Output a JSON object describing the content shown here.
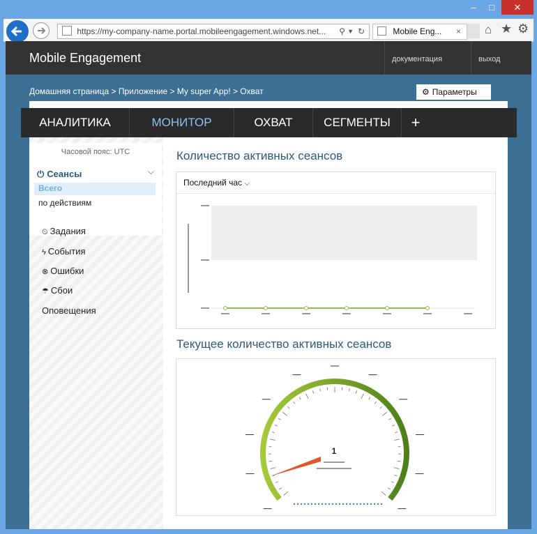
{
  "browser": {
    "url": "https://my-company-name.portal.mobileengagement.windows.net...",
    "tab_title": "Mobile Eng...",
    "tab_close": "×",
    "title_buttons": [
      "–",
      "□",
      "✕"
    ]
  },
  "header": {
    "app_title": "Mobile Engagement",
    "docs_link": "документация",
    "logout_link": "выход"
  },
  "breadcrumb": "Домашняя страница > Приложение > My super App! > Охват",
  "params_button": "Параметры",
  "topnav": {
    "items": [
      "АНАЛИТИКА",
      "МОНИТОР",
      "ОХВАТ",
      "СЕГМЕНТЫ"
    ],
    "active": "МОНИТОР",
    "add_label": "+"
  },
  "sidebar": {
    "timezone": "Часовой пояс: UTC",
    "sessions_label": "Сеансы",
    "sub_items": [
      "Всего",
      "по действиям"
    ],
    "items": [
      {
        "label": "Задания",
        "icon": "timer-icon"
      },
      {
        "label": "События",
        "icon": "lightning-icon"
      },
      {
        "label": "Ошибки",
        "icon": "error-icon"
      },
      {
        "label": "Сбои",
        "icon": "umbrella-icon"
      }
    ],
    "alerts_label": "Оповещения"
  },
  "active_sessions": {
    "title": "Количество активных сеансов",
    "range_selector": "Последний час",
    "chart_data": {
      "type": "line",
      "series": [
        {
          "values": [
            0,
            0,
            0,
            0,
            0,
            0
          ]
        }
      ],
      "grid": true
    }
  },
  "current_sessions": {
    "title": "Текущее количество активных сеансов",
    "gauge": {
      "value": 1,
      "value_label": "1",
      "needle_color": "#e0552a",
      "arc_colors": [
        "#a6c93a",
        "#4e7f1a"
      ]
    }
  },
  "colors": {
    "accent": "#2b5a7e",
    "header_bg": "#333333",
    "content_bg": "#3d6f95",
    "selected_sub_bg": "#dfeef8"
  }
}
